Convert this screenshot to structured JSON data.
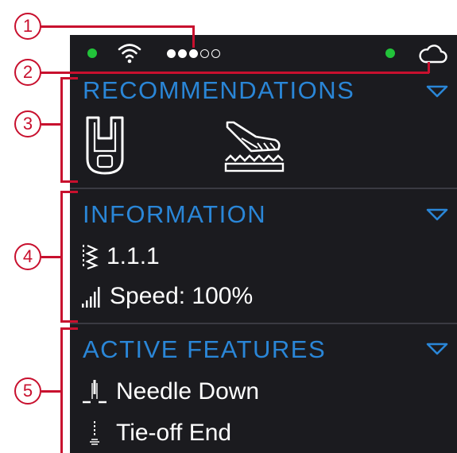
{
  "colors": {
    "screen_bg": "#1b1b1f",
    "accent": "#2a86d7",
    "status_green": "#22c33a",
    "callout_red": "#c8102e"
  },
  "status_bar": {
    "left_indicator_icon": "green-status-dot",
    "wifi_icon": "wifi-icon",
    "page_dots_total": 5,
    "page_dots_active": 3,
    "right_indicator_icon": "green-status-dot",
    "cloud_icon": "cloud-icon"
  },
  "sections": {
    "recommendations": {
      "title": "RECOMMENDATIONS",
      "icons": [
        "presser-foot-icon",
        "feed-dogs-icon"
      ]
    },
    "information": {
      "title": "INFORMATION",
      "stitch_number": "1.1.1",
      "speed_label": "Speed: 100%"
    },
    "active_features": {
      "title": "ACTIVE FEATURES",
      "items": [
        "Needle Down",
        "Tie-off End"
      ]
    }
  },
  "callouts": [
    "1",
    "2",
    "3",
    "4",
    "5"
  ]
}
